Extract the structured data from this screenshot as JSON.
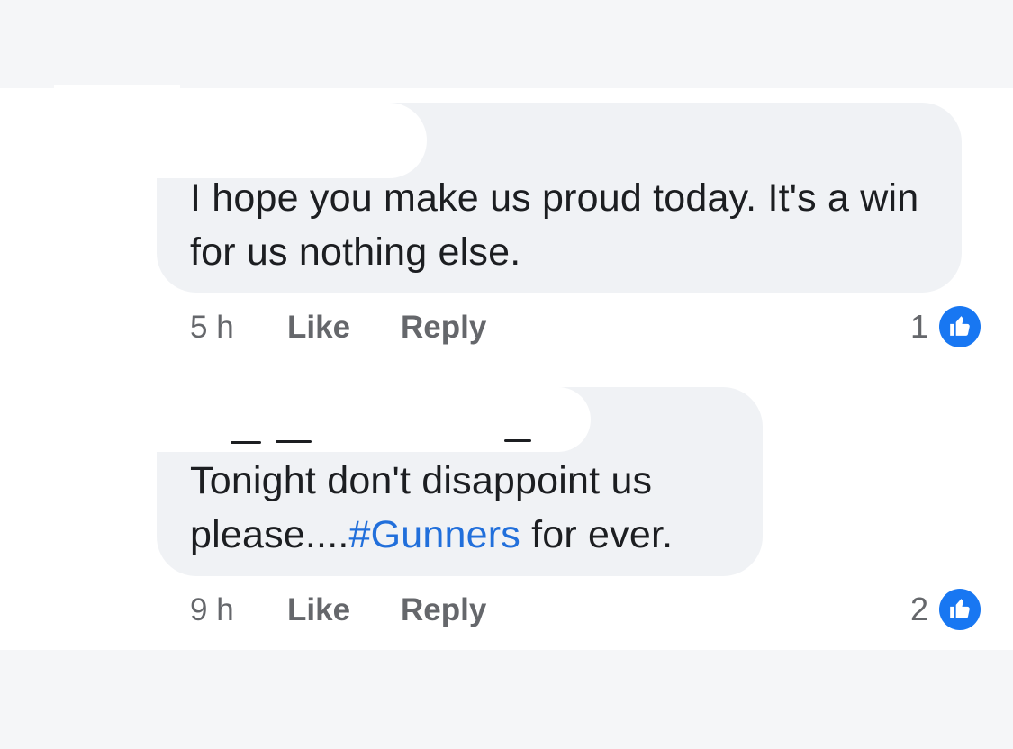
{
  "colors": {
    "bubble": "#f0f2f5",
    "text": "#1c1e21",
    "meta": "#65676b",
    "hashtag": "#216fdb",
    "like_badge": "#1877f2"
  },
  "comments": [
    {
      "text": "I hope you make us proud today. It's a win for us nothing else.",
      "time": "5 h",
      "like_label": "Like",
      "reply_label": "Reply",
      "reaction_count": "1",
      "reaction_icon": "thumbs-up-icon"
    },
    {
      "text_before": "Tonight don't disappoint us please....",
      "hashtag": "#Gunners",
      "text_after": " for ever.",
      "time": "9 h",
      "like_label": "Like",
      "reply_label": "Reply",
      "reaction_count": "2",
      "reaction_icon": "thumbs-up-icon"
    }
  ]
}
